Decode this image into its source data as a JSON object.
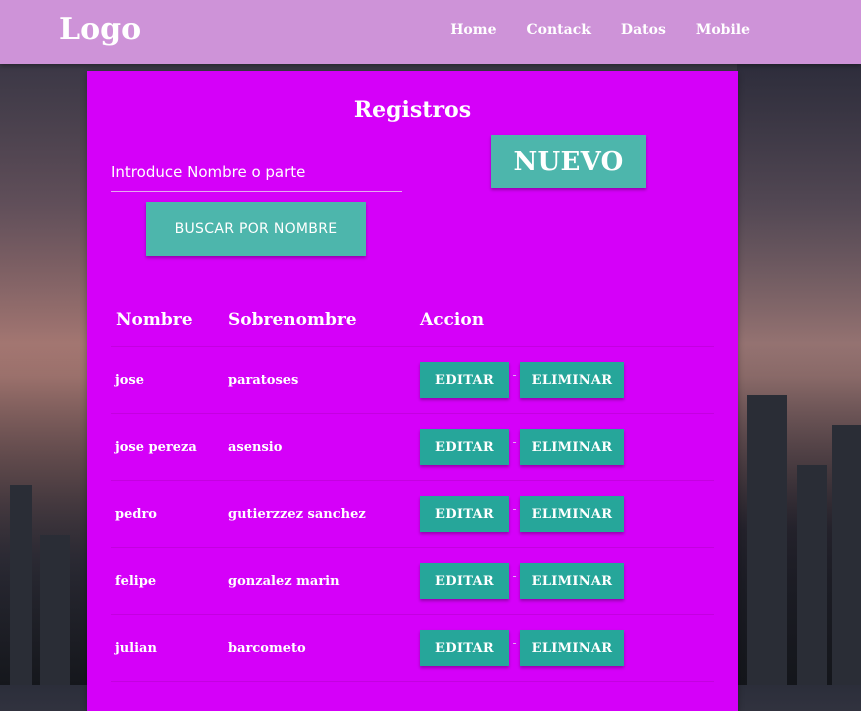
{
  "nav": {
    "logo": "Logo",
    "links": [
      "Home",
      "Contack",
      "Datos",
      "Mobile"
    ]
  },
  "card": {
    "title": "Registros",
    "search_placeholder": "Introduce Nombre o parte",
    "search_button": "BUSCAR POR NOMBRE",
    "new_button": "NUEVO"
  },
  "table": {
    "headers": [
      "Nombre",
      "Sobrenombre",
      "Accion"
    ],
    "edit_label": "EDITAR",
    "delete_label": "ELIMINAR",
    "separator": "-",
    "rows": [
      {
        "nombre": "jose",
        "sobrenombre": "paratoses"
      },
      {
        "nombre": "jose pereza",
        "sobrenombre": "asensio"
      },
      {
        "nombre": "pedro",
        "sobrenombre": "gutierzzez sanchez"
      },
      {
        "nombre": "felipe",
        "sobrenombre": "gonzalez marin"
      },
      {
        "nombre": "julian",
        "sobrenombre": "barcometo"
      }
    ]
  },
  "colors": {
    "navbar": "#ce93d8",
    "card": "#d500f9",
    "button": "#26a69a"
  }
}
